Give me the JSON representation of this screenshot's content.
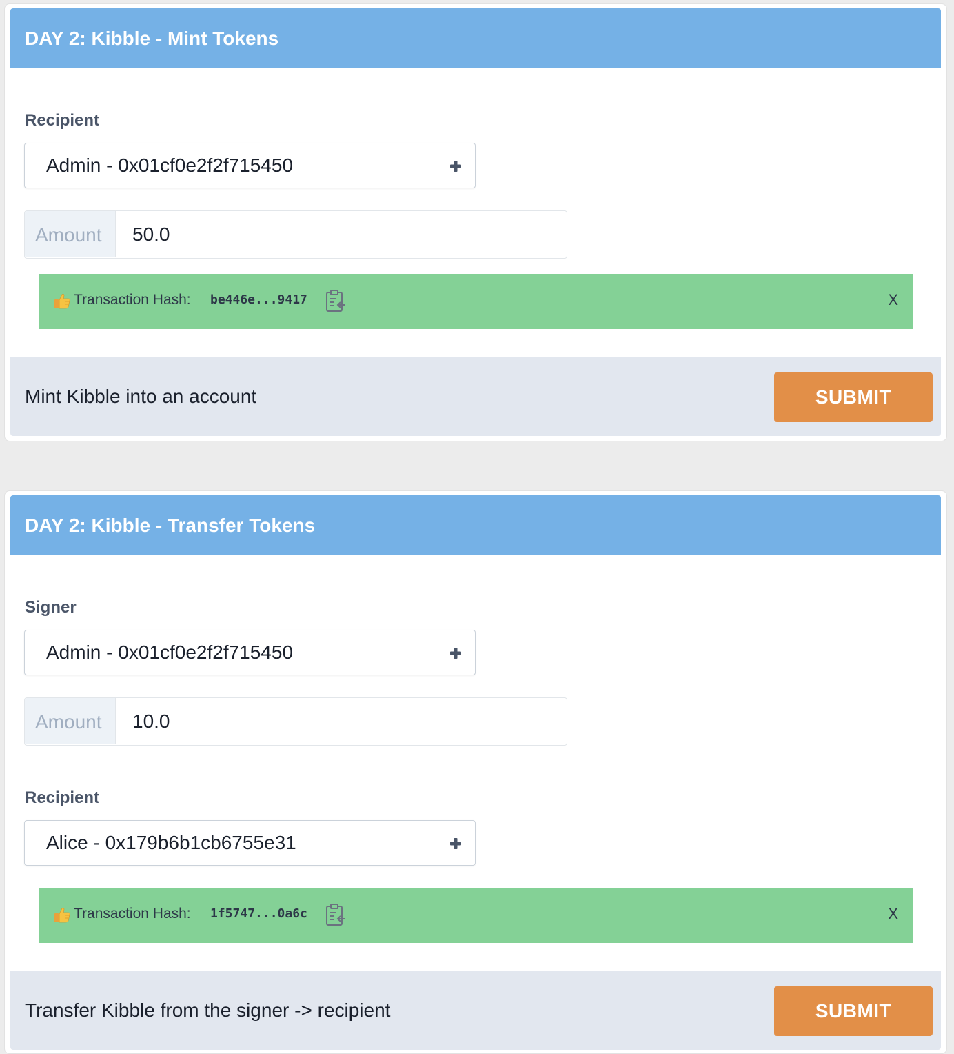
{
  "mint": {
    "title": "DAY 2: Kibble - Mint Tokens",
    "recipient_label": "Recipient",
    "recipient_value": "Admin - 0x01cf0e2f2f715450",
    "amount_addon": "Amount",
    "amount_value": "50.0",
    "alert": {
      "label": "Transaction Hash:",
      "hash": "be446e...9417",
      "close": "X"
    },
    "footer_text": "Mint Kibble into an account",
    "submit_label": "SUBMIT"
  },
  "transfer": {
    "title": "DAY 2: Kibble - Transfer Tokens",
    "signer_label": "Signer",
    "signer_value": "Admin - 0x01cf0e2f2f715450",
    "amount_addon": "Amount",
    "amount_value": "10.0",
    "recipient_label": "Recipient",
    "recipient_value": "Alice - 0x179b6b1cb6755e31",
    "alert": {
      "label": "Transaction Hash:",
      "hash": "1f5747...0a6c",
      "close": "X"
    },
    "footer_text": "Transfer Kibble from the signer -> recipient",
    "submit_label": "SUBMIT"
  },
  "icons": {
    "select": "plus-icon",
    "alert_emoji": "thumbs-up-icon",
    "copy": "clipboard-icon"
  },
  "colors": {
    "header": "#75b1e6",
    "alert_success": "#84d196",
    "submit": "#e28f48",
    "footer": "#e2e7ef"
  }
}
